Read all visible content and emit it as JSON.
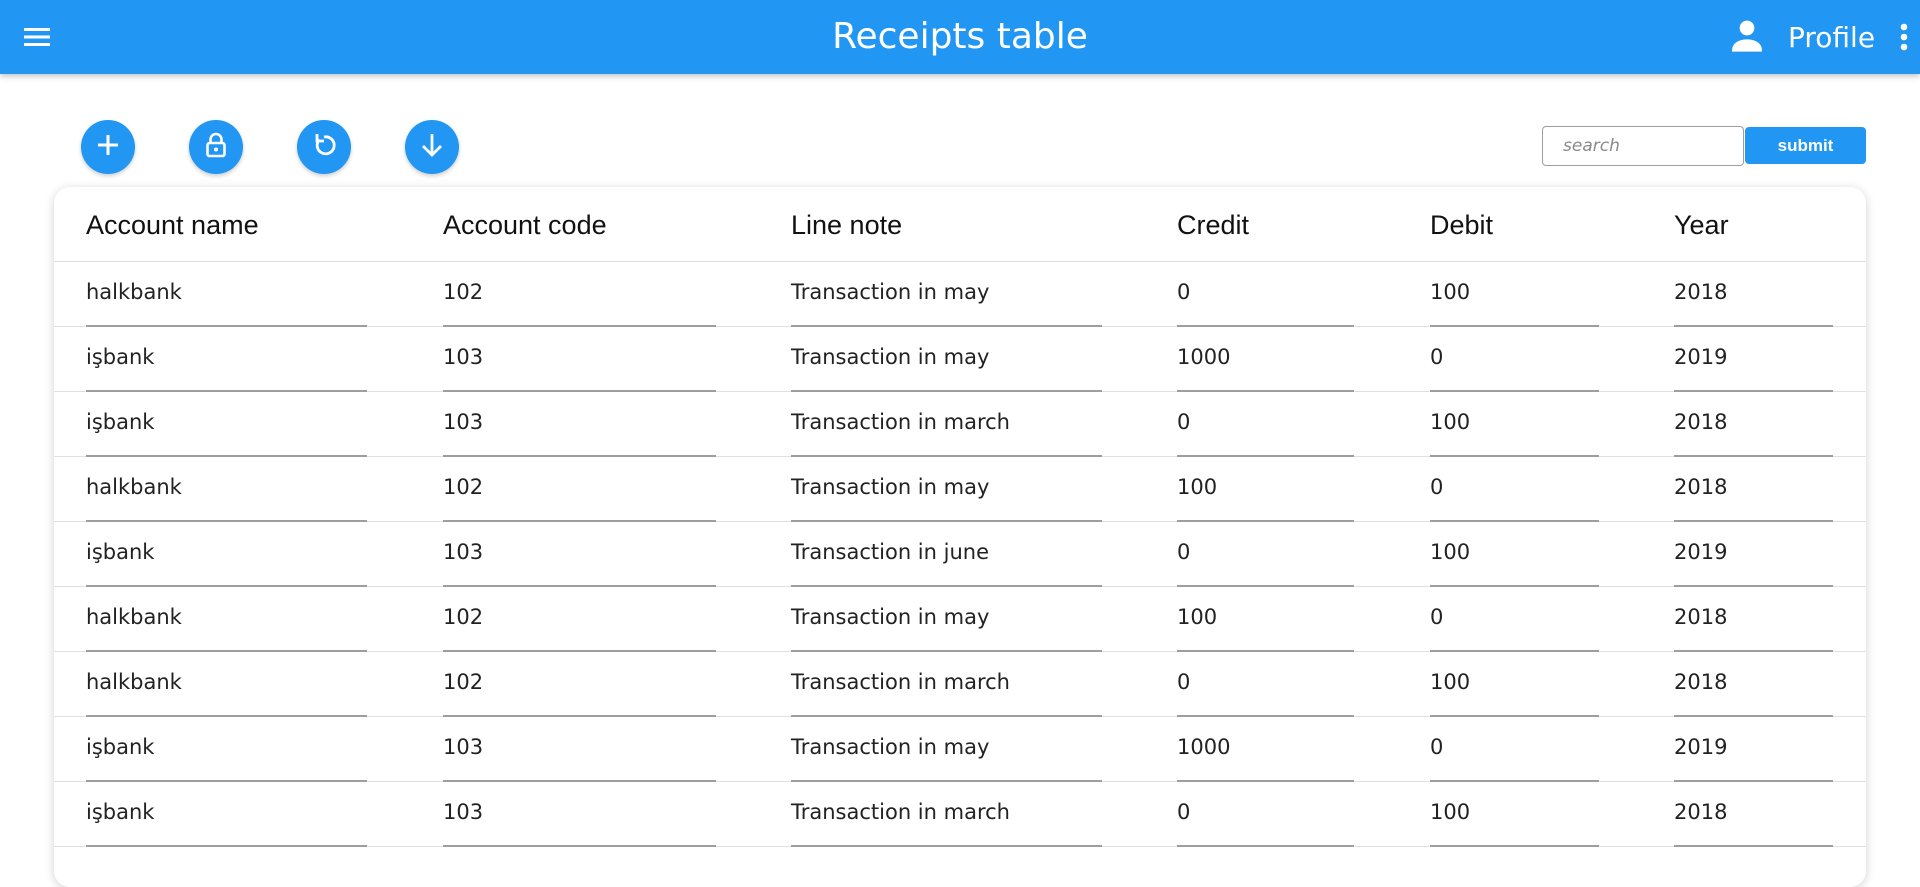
{
  "appbar": {
    "title": "Receipts table",
    "profile_label": "Profile"
  },
  "toolbar": {
    "actions": [
      {
        "name": "add-icon"
      },
      {
        "name": "lock-open-icon"
      },
      {
        "name": "refresh-icon"
      },
      {
        "name": "arrow-down-icon"
      }
    ]
  },
  "search": {
    "placeholder": "search",
    "value": "",
    "submit_label": "submit"
  },
  "colors": {
    "primary": "#2196f3",
    "underline": "#9e9e9e"
  },
  "table": {
    "columns": [
      "Account name",
      "Account code",
      "Line note",
      "Credit",
      "Debit",
      "Year"
    ],
    "rows": [
      [
        "halkbank",
        "102",
        "Transaction in may",
        "0",
        "100",
        "2018"
      ],
      [
        "işbank",
        "103",
        "Transaction in may",
        "1000",
        "0",
        "2019"
      ],
      [
        "işbank",
        "103",
        "Transaction in march",
        "0",
        "100",
        "2018"
      ],
      [
        "halkbank",
        "102",
        "Transaction in may",
        "100",
        "0",
        "2018"
      ],
      [
        "işbank",
        "103",
        "Transaction in june",
        "0",
        "100",
        "2019"
      ],
      [
        "halkbank",
        "102",
        "Transaction in may",
        "100",
        "0",
        "2018"
      ],
      [
        "halkbank",
        "102",
        "Transaction in march",
        "0",
        "100",
        "2018"
      ],
      [
        "işbank",
        "103",
        "Transaction in may",
        "1000",
        "0",
        "2019"
      ],
      [
        "işbank",
        "103",
        "Transaction in march",
        "0",
        "100",
        "2018"
      ]
    ]
  }
}
